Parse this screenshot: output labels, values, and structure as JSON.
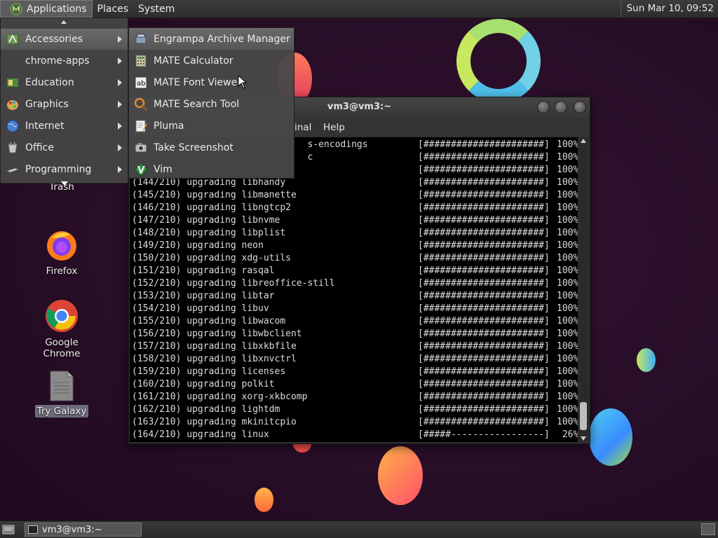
{
  "top_panel": {
    "menus": [
      "Applications",
      "Places",
      "System"
    ],
    "clock": "Sun Mar 10, 09:52"
  },
  "app_menu": {
    "items": [
      {
        "label": "Accessories",
        "icon": "accessories-icon"
      },
      {
        "label": "chrome-apps",
        "icon": ""
      },
      {
        "label": "Education",
        "icon": "education-icon"
      },
      {
        "label": "Graphics",
        "icon": "graphics-icon"
      },
      {
        "label": "Internet",
        "icon": "internet-icon"
      },
      {
        "label": "Office",
        "icon": "office-icon"
      },
      {
        "label": "Programming",
        "icon": "programming-icon"
      }
    ]
  },
  "accessories_menu": {
    "items": [
      {
        "label": "Engrampa Archive Manager",
        "icon": "archive-icon"
      },
      {
        "label": "MATE Calculator",
        "icon": "calculator-icon"
      },
      {
        "label": "MATE Font Viewer",
        "icon": "font-viewer-icon"
      },
      {
        "label": "MATE Search Tool",
        "icon": "search-tool-icon"
      },
      {
        "label": "Pluma",
        "icon": "text-editor-icon"
      },
      {
        "label": "Take Screenshot",
        "icon": "screenshot-icon"
      },
      {
        "label": "Vim",
        "icon": "vim-icon"
      }
    ]
  },
  "desktop": {
    "icons": [
      {
        "label": "Trash"
      },
      {
        "label": "Firefox"
      },
      {
        "label": "Google Chrome"
      },
      {
        "label": "Try Galaxy"
      }
    ]
  },
  "terminal": {
    "title": "vm3@vm3:~",
    "menus": [
      "inal",
      "Help"
    ],
    "lines": [
      {
        "text": "                                s-encodings",
        "bar": "[######################]",
        "pct": "100%"
      },
      {
        "text": "                                c",
        "bar": "[######################]",
        "pct": "100%"
      },
      {
        "text": "",
        "bar": "[######################]",
        "pct": "100%"
      },
      {
        "text": "(144/210) upgrading libhandy",
        "bar": "[######################]",
        "pct": "100%"
      },
      {
        "text": "(145/210) upgrading libmanette",
        "bar": "[######################]",
        "pct": "100%"
      },
      {
        "text": "(146/210) upgrading libngtcp2",
        "bar": "[######################]",
        "pct": "100%"
      },
      {
        "text": "(147/210) upgrading libnvme",
        "bar": "[######################]",
        "pct": "100%"
      },
      {
        "text": "(148/210) upgrading libplist",
        "bar": "[######################]",
        "pct": "100%"
      },
      {
        "text": "(149/210) upgrading neon",
        "bar": "[######################]",
        "pct": "100%"
      },
      {
        "text": "(150/210) upgrading xdg-utils",
        "bar": "[######################]",
        "pct": "100%"
      },
      {
        "text": "(151/210) upgrading rasqal",
        "bar": "[######################]",
        "pct": "100%"
      },
      {
        "text": "(152/210) upgrading libreoffice-still",
        "bar": "[######################]",
        "pct": "100%"
      },
      {
        "text": "(153/210) upgrading libtar",
        "bar": "[######################]",
        "pct": "100%"
      },
      {
        "text": "(154/210) upgrading libuv",
        "bar": "[######################]",
        "pct": "100%"
      },
      {
        "text": "(155/210) upgrading libwacom",
        "bar": "[######################]",
        "pct": "100%"
      },
      {
        "text": "(156/210) upgrading libwbclient",
        "bar": "[######################]",
        "pct": "100%"
      },
      {
        "text": "(157/210) upgrading libxkbfile",
        "bar": "[######################]",
        "pct": "100%"
      },
      {
        "text": "(158/210) upgrading libxnvctrl",
        "bar": "[######################]",
        "pct": "100%"
      },
      {
        "text": "(159/210) upgrading licenses",
        "bar": "[######################]",
        "pct": "100%"
      },
      {
        "text": "(160/210) upgrading polkit",
        "bar": "[######################]",
        "pct": "100%"
      },
      {
        "text": "(161/210) upgrading xorg-xkbcomp",
        "bar": "[######################]",
        "pct": "100%"
      },
      {
        "text": "(162/210) upgrading lightdm",
        "bar": "[######################]",
        "pct": "100%"
      },
      {
        "text": "(163/210) upgrading mkinitcpio",
        "bar": "[######################]",
        "pct": "100%"
      },
      {
        "text": "(164/210) upgrading linux",
        "bar": "[#####-----------------]",
        "pct": " 26%"
      }
    ]
  },
  "taskbar": {
    "window_button": "vm3@vm3:~"
  }
}
